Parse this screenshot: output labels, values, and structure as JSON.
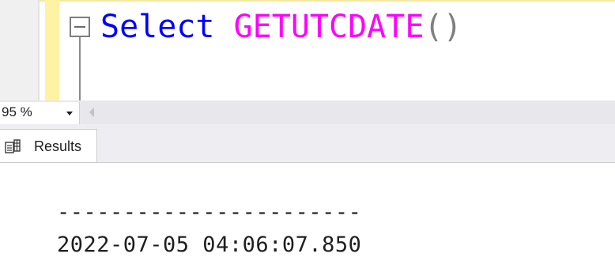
{
  "editor": {
    "keyword": "Select",
    "function": "GETUTCDATE",
    "parens": "()"
  },
  "zoom": {
    "value": "95 %"
  },
  "results_tab": {
    "label": "Results",
    "icon": "results-grid-icon"
  },
  "results": {
    "column_header_separator": "-----------------------",
    "rows": [
      "2022-07-05 04:06:07.850"
    ]
  },
  "colors": {
    "keyword": "#0000ff",
    "function": "#ff00ff",
    "paren": "#808080",
    "change_bar": "#fff2a3"
  }
}
